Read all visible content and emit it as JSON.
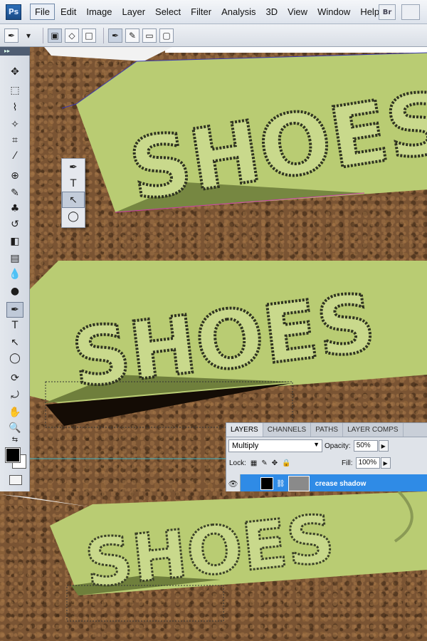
{
  "app": {
    "logo": "Ps",
    "browse_button": "Br"
  },
  "menubar": {
    "items": [
      {
        "label": "File",
        "active": true
      },
      {
        "label": "Edit"
      },
      {
        "label": "Image"
      },
      {
        "label": "Layer"
      },
      {
        "label": "Select"
      },
      {
        "label": "Filter"
      },
      {
        "label": "Analysis"
      },
      {
        "label": "3D"
      },
      {
        "label": "View"
      },
      {
        "label": "Window"
      },
      {
        "label": "Help"
      }
    ]
  },
  "artwork": {
    "sign_text": "SHOES",
    "sign_color": "#b9cc73",
    "shadow_color": "#6f7f3c"
  },
  "tool_flyout": {
    "items": [
      "pen-icon",
      "type-icon",
      "direct-select-icon",
      "ellipse-icon"
    ]
  },
  "layers_panel": {
    "tabs": [
      "LAYERS",
      "CHANNELS",
      "PATHS",
      "LAYER COMPS"
    ],
    "blend_mode": "Multiply",
    "opacity_label": "Opacity:",
    "opacity_value": "50%",
    "lock_label": "Lock:",
    "fill_label": "Fill:",
    "fill_value": "100%",
    "selected_layer": {
      "name": "crease shadow"
    },
    "selection_color": "#2f8be6"
  }
}
